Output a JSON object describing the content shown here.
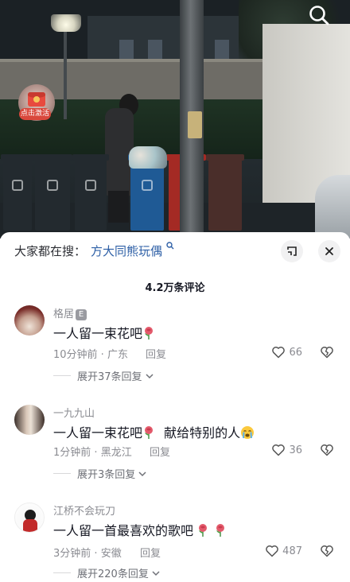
{
  "video": {
    "redpacket_label": "点击激活"
  },
  "icons": {
    "search": "search-icon",
    "redpacket": "red-envelope-icon",
    "collapse": "minimize-icon",
    "close": "close-icon",
    "like": "heart-icon",
    "dislike": "broken-heart-icon",
    "chevron": "chevron-down-icon",
    "rose": "rose-emoji",
    "cry": "crying-face-emoji"
  },
  "search_bar": {
    "label": "大家都在搜：",
    "query": "方大同熊玩偶"
  },
  "comments_header": {
    "count": "4.2万条评论"
  },
  "comments": [
    {
      "username": "格居",
      "badge": "E",
      "text": "一人留一束花吧",
      "time": "10分钟前",
      "location": "广东",
      "reply_label": "回复",
      "likes": "66",
      "expand": "展开37条回复"
    },
    {
      "username": "一九九山",
      "text_a": "一人留一束花吧",
      "text_b": "献给特别的人",
      "time": "1分钟前",
      "location": "黑龙江",
      "reply_label": "回复",
      "likes": "36",
      "expand": "展开3条回复"
    },
    {
      "username": "江桥不会玩刀",
      "text": "一人留一首最喜欢的歌吧",
      "time": "3分钟前",
      "location": "安徽",
      "reply_label": "回复",
      "likes": "487",
      "expand": "展开220条回复"
    }
  ],
  "colors": {
    "link": "#2d5fa6",
    "text": "#161823",
    "muted": "#8a8b91"
  }
}
